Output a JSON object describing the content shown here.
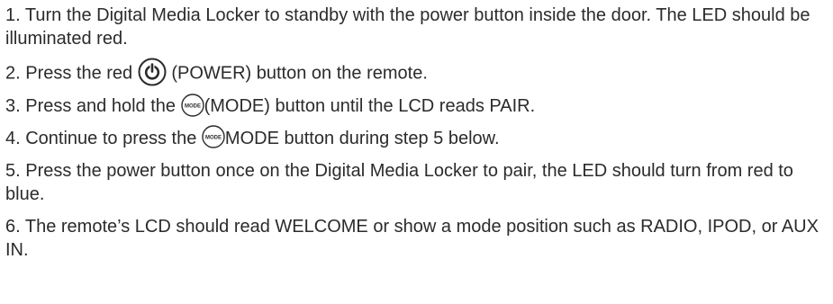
{
  "steps": [
    {
      "text": "1. Turn the Digital Media Locker to standby with the power button inside the door.  The LED should be illuminated red."
    },
    {
      "before": "2. Press the red ",
      "icon": "power-icon",
      "after": "(POWER) button on the remote."
    },
    {
      "before": "3. Press and hold the ",
      "icon": "mode-icon",
      "icon_label": "MODE",
      "after": "(MODE) button until the LCD reads PAIR."
    },
    {
      "before": "4. Continue to press the ",
      "icon": "mode-icon",
      "icon_label": "MODE",
      "after": "MODE button during step 5 below."
    },
    {
      "text": "5. Press the power button once on the Digital Media Locker to pair, the LED should turn from red to blue."
    },
    {
      "text": "6. The remote’s LCD should read WELCOME or show a mode position such as RADIO, IPOD, or AUX IN."
    }
  ]
}
